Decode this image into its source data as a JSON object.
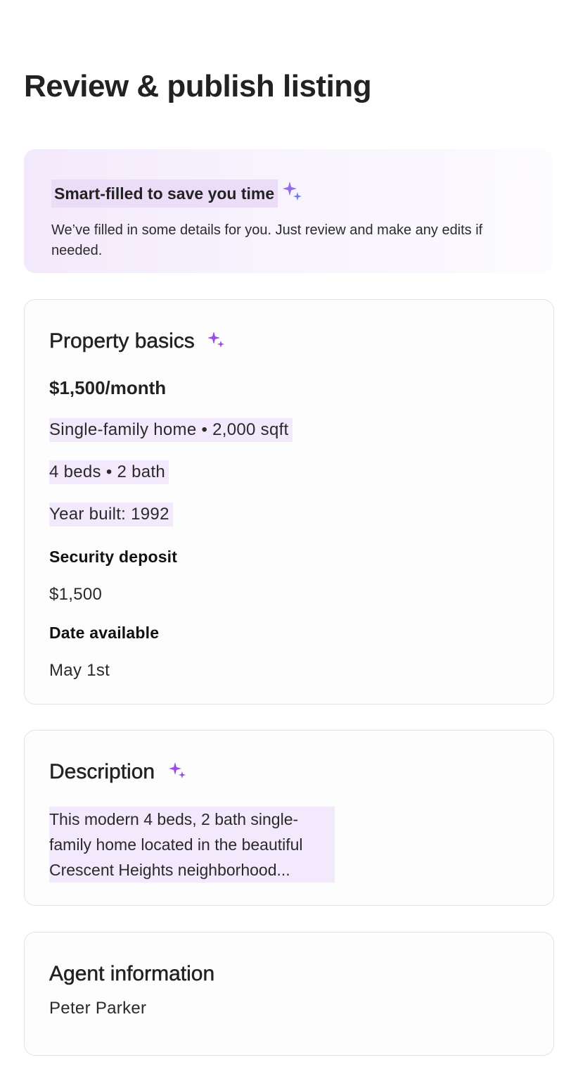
{
  "page": {
    "title": "Review & publish listing"
  },
  "smart_banner": {
    "title": "Smart-filled to save you time",
    "text": "We’ve filled in some details for you. Just review and make any edits if needed.",
    "icon": "sparkle-icon"
  },
  "property_basics": {
    "heading": "Property basics",
    "price": "$1,500/month",
    "home_type_size": "Single-family home • 2,000 sqft",
    "beds_baths": "4 beds • 2 bath",
    "year_built": "Year built: 1992",
    "security_deposit_label": "Security deposit",
    "security_deposit_value": "$1,500",
    "date_available_label": "Date available",
    "date_available_value": "May 1st"
  },
  "description": {
    "heading": "Description",
    "text": "This modern 4 beds, 2 bath single-family home located in the beautiful Crescent Heights neighborhood..."
  },
  "agent": {
    "heading": "Agent information",
    "name": "Peter Parker"
  },
  "colors": {
    "accent_purple": "#9b4de6",
    "accent_blue": "#6c7cf0",
    "highlight": "#f3e9fc",
    "border": "#e4e4e6"
  }
}
